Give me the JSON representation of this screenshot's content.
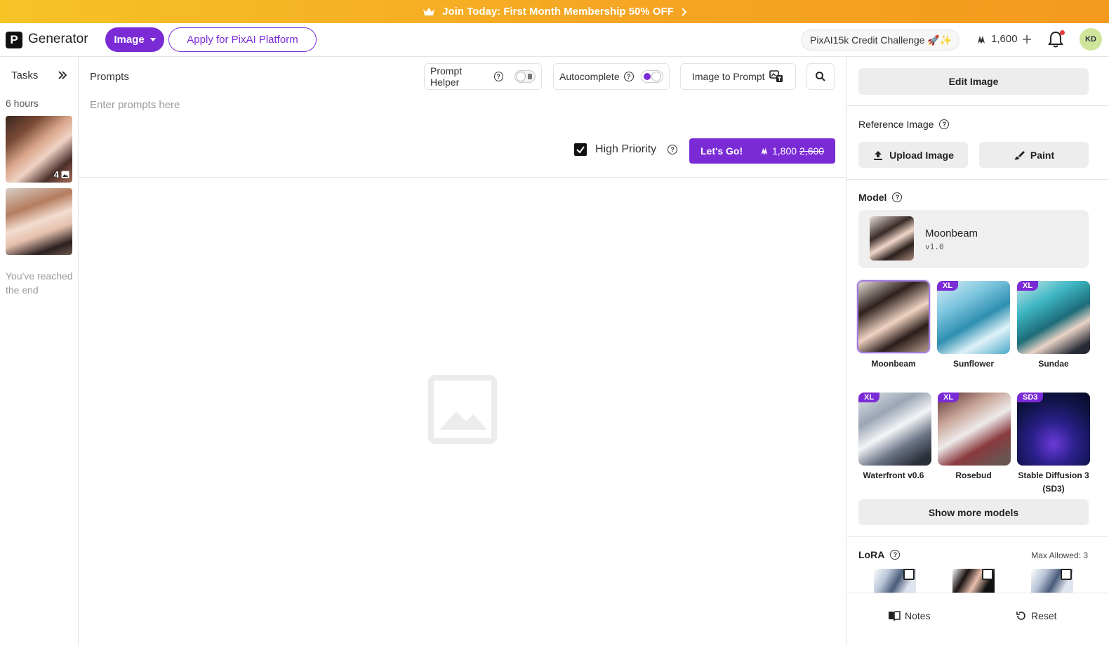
{
  "banner": {
    "text": "Join Today: First Month Membership 50% OFF",
    "icon": "crown-icon"
  },
  "header": {
    "logo_letter": "P",
    "brand": "Generator",
    "mode_button": "Image",
    "apply_button": "Apply for PixAI Platform",
    "challenge": "PixAI15k Credit Challenge 🚀✨",
    "credits": "1,600",
    "avatar_initials": "KD"
  },
  "tasks": {
    "title": "Tasks",
    "time_group": "6 hours",
    "items": [
      {
        "count": "4"
      },
      {
        "count": ""
      }
    ],
    "end_text": "You've reached the end"
  },
  "prompt": {
    "label": "Prompts",
    "placeholder": "Enter prompts here",
    "prompt_helper": {
      "label": "Prompt Helper",
      "enabled": false
    },
    "autocomplete": {
      "label": "Autocomplete",
      "enabled": true
    },
    "image_to_prompt": "Image to Prompt",
    "high_priority": {
      "label": "High Priority",
      "checked": true
    },
    "go_button": {
      "label": "Let's Go!",
      "cost": "1,800",
      "original_cost": "2,600"
    }
  },
  "right_panel": {
    "edit_image": "Edit Image",
    "reference_image": {
      "title": "Reference Image",
      "upload": "Upload Image",
      "paint": "Paint"
    },
    "model": {
      "title": "Model",
      "selected_name": "Moonbeam",
      "selected_version": "v1.0",
      "options": [
        {
          "name": "Moonbeam",
          "badge": ""
        },
        {
          "name": "Sunflower",
          "badge": "XL"
        },
        {
          "name": "Sundae",
          "badge": "XL"
        },
        {
          "name": "Waterfront v0.6",
          "badge": "XL"
        },
        {
          "name": "Rosebud",
          "badge": "XL"
        },
        {
          "name": "Stable Diffusion 3 (SD3)",
          "badge": "SD3"
        }
      ],
      "show_more": "Show more models"
    },
    "lora": {
      "title": "LoRA",
      "max_allowed": "Max Allowed: 3"
    },
    "bottom": {
      "notes": "Notes",
      "reset": "Reset"
    }
  },
  "colors": {
    "accent": "#7b2bd6",
    "banner": "#f5a623"
  }
}
